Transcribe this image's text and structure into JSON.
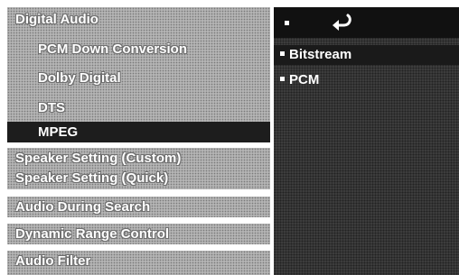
{
  "menu": {
    "digital_audio": "Digital Audio",
    "items": [
      "PCM Down Conversion",
      "Dolby Digital",
      "DTS",
      "MPEG"
    ],
    "speaker_custom": "Speaker Setting (Custom)",
    "speaker_quick": "Speaker Setting (Quick)",
    "audio_search": "Audio  During Search",
    "dynamic_range": "Dynamic Range Control",
    "audio_filter": "Audio Filter"
  },
  "panel": {
    "header_icon": "return-icon",
    "options": [
      "Bitstream",
      "PCM"
    ]
  }
}
